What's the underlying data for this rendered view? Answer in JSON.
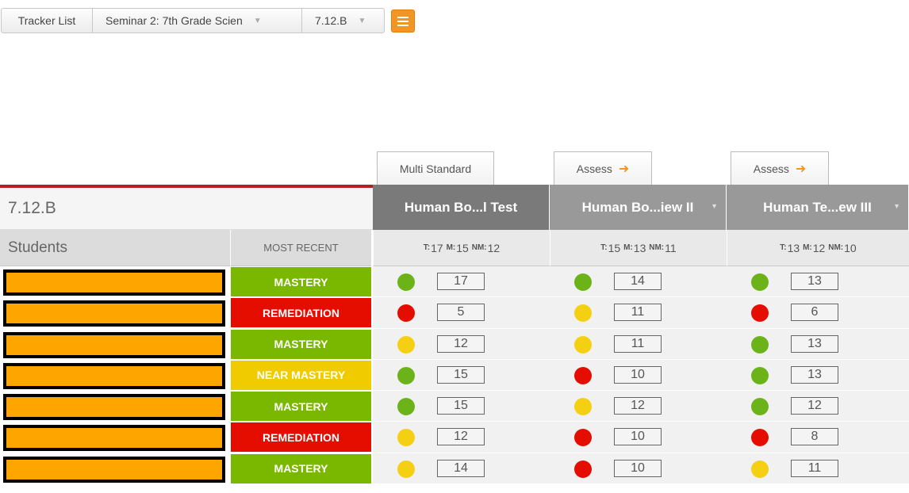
{
  "toolbar": {
    "tracker_list": "Tracker List",
    "seminar": "Seminar 2: 7th Grade Scien",
    "standard": "7.12.B"
  },
  "tabs": {
    "multi_standard": "Multi Standard",
    "assess1": "Assess",
    "assess2": "Assess"
  },
  "table": {
    "standard_title": "7.12.B",
    "students_label": "Students",
    "most_recent_label": "MOST RECENT",
    "assessments": [
      {
        "title": "Human Bo...l Test",
        "t": "17",
        "m": "15",
        "nm": "12",
        "header_color": "#7a7a7a"
      },
      {
        "title": "Human Bo...iew II",
        "t": "15",
        "m": "13",
        "nm": "11",
        "header_color": "#999999"
      },
      {
        "title": "Human Te...ew III",
        "t": "13",
        "m": "12",
        "nm": "10",
        "header_color": "#999999"
      }
    ],
    "stat_labels": {
      "t": "T:",
      "m": "M:",
      "nm": "NM:"
    },
    "rows": [
      {
        "status": "MASTERY",
        "scores": [
          [
            "g",
            "17"
          ],
          [
            "g",
            "14"
          ],
          [
            "g",
            "13"
          ]
        ]
      },
      {
        "status": "REMEDIATION",
        "scores": [
          [
            "r",
            "5"
          ],
          [
            "y",
            "11"
          ],
          [
            "r",
            "6"
          ]
        ]
      },
      {
        "status": "MASTERY",
        "scores": [
          [
            "y",
            "12"
          ],
          [
            "y",
            "11"
          ],
          [
            "g",
            "13"
          ]
        ]
      },
      {
        "status": "NEAR MASTERY",
        "scores": [
          [
            "g",
            "15"
          ],
          [
            "r",
            "10"
          ],
          [
            "g",
            "13"
          ]
        ]
      },
      {
        "status": "MASTERY",
        "scores": [
          [
            "g",
            "15"
          ],
          [
            "y",
            "12"
          ],
          [
            "g",
            "12"
          ]
        ]
      },
      {
        "status": "REMEDIATION",
        "scores": [
          [
            "y",
            "12"
          ],
          [
            "r",
            "10"
          ],
          [
            "r",
            "8"
          ]
        ]
      },
      {
        "status": "MASTERY",
        "scores": [
          [
            "y",
            "14"
          ],
          [
            "r",
            "10"
          ],
          [
            "y",
            "11"
          ]
        ]
      }
    ]
  },
  "colors": {
    "mastery": "#7ab800",
    "remediation": "#e50d00",
    "near_mastery": "#f0cb00",
    "accent": "#f39524",
    "redacted": "#ffa500"
  }
}
